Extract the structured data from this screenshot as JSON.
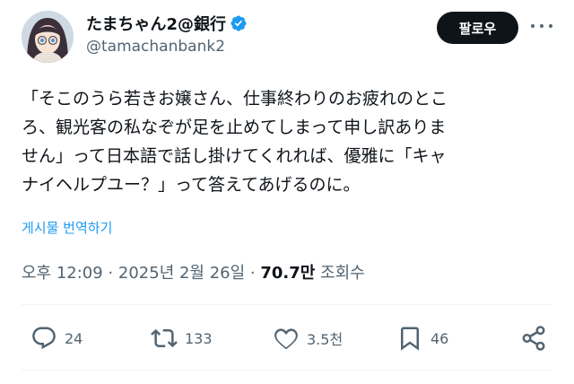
{
  "author": {
    "display_name": "たまちゃん2@銀行",
    "handle": "@tamachanbank2"
  },
  "follow_label": "팔로우",
  "tweet": {
    "lines": [
      "「そこのうら若きお嬢さん、仕事終わりのお疲れのとこ",
      "ろ、観光客の私なぞが足を止めてしまって申し訳ありま",
      "せん」って日本語で話し掛けてくれれば、優雅に「キャ",
      "ナイヘルプユー？」って答えてあげるのに。"
    ]
  },
  "translate_label": "게시물 번역하기",
  "meta": {
    "timestamp": "오후 12:09 · 2025년 2월 26일 · ",
    "views_count": "70.7만",
    "views_label": " 조회수"
  },
  "actions": {
    "replies": "24",
    "reposts": "133",
    "likes": "3.5천",
    "bookmarks": "46"
  },
  "colors": {
    "accent": "#1d9bf0",
    "text": "#0f1419",
    "secondary": "#536471",
    "follow_bg": "#0f1419"
  }
}
